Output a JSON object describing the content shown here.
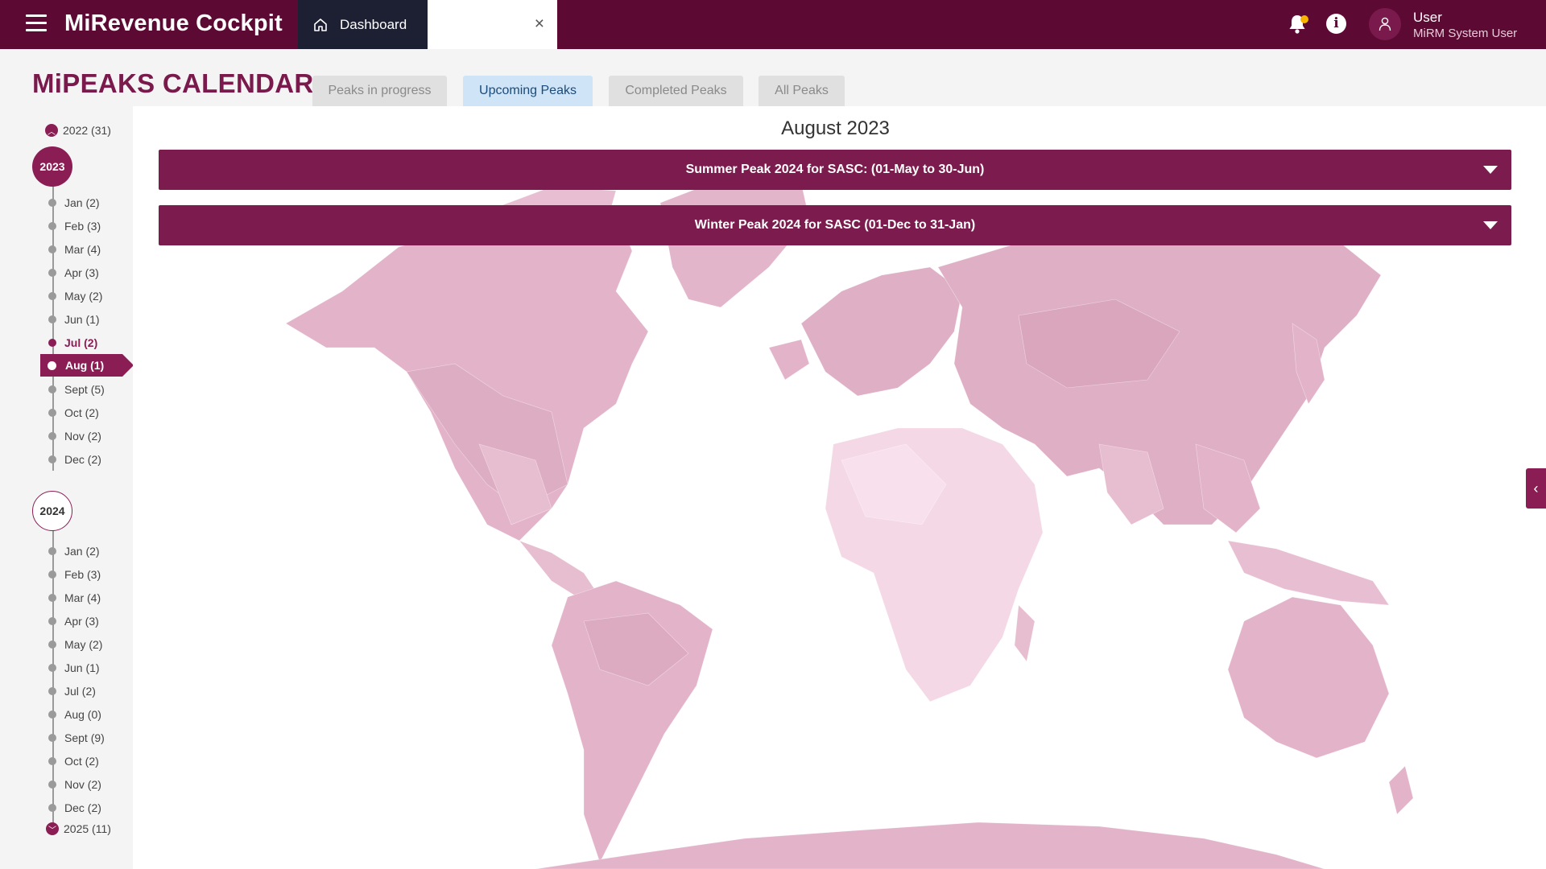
{
  "header": {
    "app_title": "MiRevenue Cockpit",
    "tabs": [
      {
        "label": "Dashboard",
        "icon": "home-icon"
      },
      {
        "label": "",
        "close_icon": "close-icon"
      }
    ],
    "icons": [
      "menu-icon",
      "bell-icon",
      "info-icon",
      "user-icon"
    ],
    "info_glyph": "i",
    "user": {
      "name": "User",
      "role": "MiRM System User"
    },
    "colors": {
      "bar": "#5c0a34",
      "active_tab": "#1d1f33",
      "notification_dot": "#f7b500"
    }
  },
  "page": {
    "title": "MiPEAKS CALENDAR",
    "filter_tabs": [
      "Peaks in progress",
      "Upcoming Peaks",
      "Completed Peaks",
      "All Peaks"
    ],
    "active_filter": "Upcoming Peaks"
  },
  "timeline": {
    "y2022": {
      "label": "2022 (31)",
      "state": "collapsed"
    },
    "y2023": {
      "label": "2023",
      "state": "expanded-active",
      "months": [
        "Jan (2)",
        "Feb (3)",
        "Mar (4)",
        "Apr (3)",
        "May (2)",
        "Jun (1)",
        "Jul (2)",
        "Aug (1)",
        "Sept (5)",
        "Oct (2)",
        "Nov (2)",
        "Dec (2)"
      ],
      "selected": "Aug (1)"
    },
    "y2024": {
      "label": "2024",
      "state": "expanded",
      "months": [
        "Jan (2)",
        "Feb (3)",
        "Mar (4)",
        "Apr (3)",
        "May (2)",
        "Jun (1)",
        "Jul (2)",
        "Aug (0)",
        "Sept (9)",
        "Oct (2)",
        "Nov (2)",
        "Dec (2)"
      ]
    },
    "y2025": {
      "label": "2025 (11)",
      "state": "collapsed"
    }
  },
  "main": {
    "month_title": "August 2023",
    "peaks": [
      "Summer Peak 2024 for SASC: (01-May to 30-Jun)",
      "Winter Peak 2024 for SASC (01-Dec to 31-Jan)"
    ],
    "background": "world-map-illustration",
    "colors": {
      "peak_bar": "#7c1b4d",
      "accent": "#8b1d55",
      "map": "#ecc6d8"
    }
  }
}
